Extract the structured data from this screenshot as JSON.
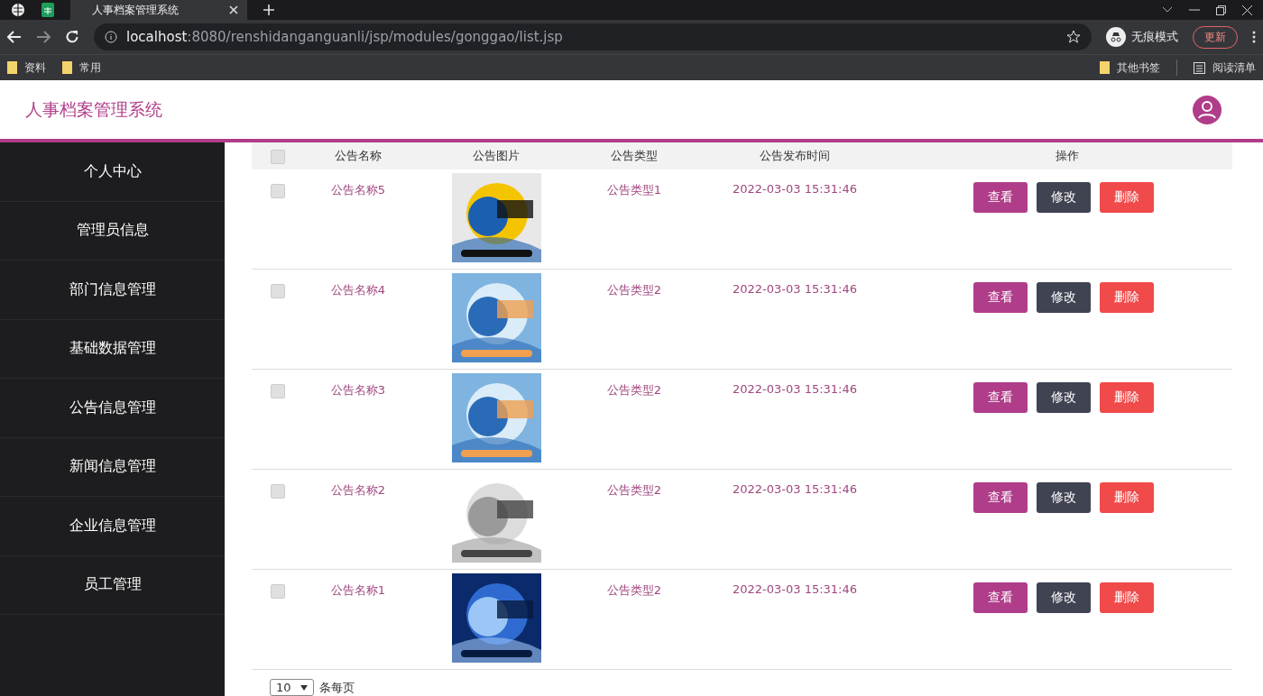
{
  "browser": {
    "tab_title": "人事档案管理系统",
    "url_host": "localhost",
    "url_rest": ":8080/renshidanganguanli/jsp/modules/gonggao/list.jsp",
    "profile": "无痕模式",
    "update_button": "更新",
    "bookmarks": [
      "资料",
      "常用"
    ],
    "other_bookmarks": "其他书签",
    "reading_list": "阅读清单"
  },
  "header": {
    "title": "人事档案管理系统"
  },
  "sidebar": {
    "items": [
      {
        "label": "个人中心",
        "selected": false
      },
      {
        "label": "管理员信息",
        "selected": false
      },
      {
        "label": "部门信息管理",
        "selected": false
      },
      {
        "label": "基础数据管理",
        "selected": false
      },
      {
        "label": "公告信息管理",
        "selected": false
      },
      {
        "label": "新闻信息管理",
        "selected": false
      },
      {
        "label": "企业信息管理",
        "selected": false
      },
      {
        "label": "员工管理",
        "selected": false
      }
    ]
  },
  "table": {
    "select_all": {
      "checked": false
    },
    "columns": [
      "公告名称",
      "公告图片",
      "公告类型",
      "公告发布时间",
      "操作"
    ],
    "rows": [
      {
        "checked": false,
        "name": "公告名称5",
        "type": "公告类型1",
        "time": "2022-03-03 15:31:46",
        "actions": [
          {
            "label": "查看",
            "kind": "view"
          },
          {
            "label": "修改",
            "kind": "edit"
          },
          {
            "label": "删除",
            "kind": "delete"
          }
        ]
      },
      {
        "checked": false,
        "name": "公告名称4",
        "type": "公告类型2",
        "time": "2022-03-03 15:31:46",
        "actions": [
          {
            "label": "查看",
            "kind": "view"
          },
          {
            "label": "修改",
            "kind": "edit"
          },
          {
            "label": "删除",
            "kind": "delete"
          }
        ]
      },
      {
        "checked": false,
        "name": "公告名称3",
        "type": "公告类型2",
        "time": "2022-03-03 15:31:46",
        "actions": [
          {
            "label": "查看",
            "kind": "view"
          },
          {
            "label": "修改",
            "kind": "edit"
          },
          {
            "label": "删除",
            "kind": "delete"
          }
        ]
      },
      {
        "checked": false,
        "name": "公告名称2",
        "type": "公告类型2",
        "time": "2022-03-03 15:31:46",
        "actions": [
          {
            "label": "查看",
            "kind": "view"
          },
          {
            "label": "修改",
            "kind": "edit"
          },
          {
            "label": "删除",
            "kind": "delete"
          }
        ]
      },
      {
        "checked": false,
        "name": "公告名称1",
        "type": "公告类型2",
        "time": "2022-03-03 15:31:46",
        "actions": [
          {
            "label": "查看",
            "kind": "view"
          },
          {
            "label": "修改",
            "kind": "edit"
          },
          {
            "label": "删除",
            "kind": "delete"
          }
        ]
      }
    ]
  },
  "pagination": {
    "page_size": "10",
    "page_size_label": "条每页"
  }
}
